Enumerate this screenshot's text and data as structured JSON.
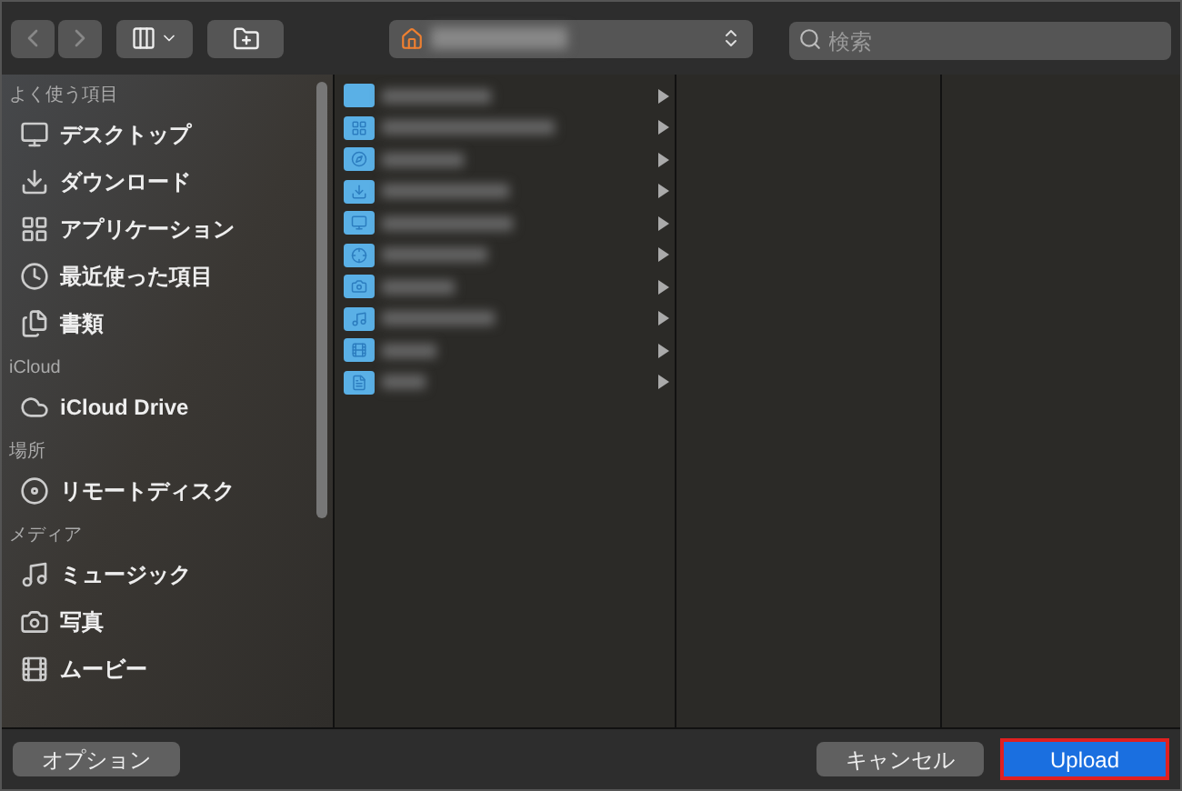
{
  "toolbar": {
    "search": {
      "placeholder": "検索"
    }
  },
  "sidebar": {
    "sections": [
      {
        "title": "よく使う項目",
        "items": [
          {
            "label": "デスクトップ"
          },
          {
            "label": "ダウンロード"
          },
          {
            "label": "アプリケーション"
          },
          {
            "label": "最近使った項目"
          },
          {
            "label": "書類"
          }
        ]
      },
      {
        "title": "iCloud",
        "items": [
          {
            "label": "iCloud Drive"
          }
        ]
      },
      {
        "title": "場所",
        "items": [
          {
            "label": "リモートディスク"
          }
        ]
      },
      {
        "title": "メディア",
        "items": [
          {
            "label": "ミュージック"
          },
          {
            "label": "写真"
          },
          {
            "label": "ムービー"
          }
        ]
      }
    ]
  },
  "buttons": {
    "options": "オプション",
    "cancel": "キャンセル",
    "upload": "Upload"
  }
}
